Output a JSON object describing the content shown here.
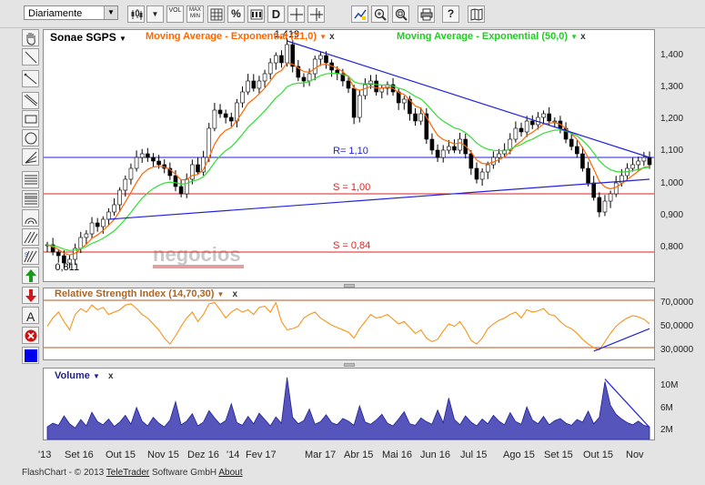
{
  "toolbar": {
    "interval": "Diariamente",
    "vol_label": "VOL",
    "maxmin_label": "MAX MIN",
    "pct_label": "%",
    "d_label": "D"
  },
  "colors": {
    "price": "#000000",
    "ema21": "#ff6600",
    "ema50": "#33dd33",
    "trendline": "#2222dd",
    "support": "#dd2222",
    "rsi": "#ff8800",
    "rsi_levels": "#bb5522",
    "volume_fill": "#5555bb",
    "accent": "#000080"
  },
  "chart_data": [
    {
      "type": "candlestick",
      "instrument": "Sonae SGPS",
      "ylim": [
        0.76,
        1.45
      ],
      "y_ticks": [
        "1,400",
        "1,300",
        "1,200",
        "1,100",
        "1,000",
        "0,900",
        "0,800"
      ],
      "series": [
        {
          "name": "Moving Average - Exponential (21,0)"
        },
        {
          "name": "Moving Average - Exponential (50,0)"
        }
      ],
      "annotations": {
        "high": "1,419",
        "low": "0,811"
      },
      "levels": [
        {
          "label": "R= 1,10",
          "value": 1.1,
          "color": "#2222dd"
        },
        {
          "label": "S = 1,00",
          "value": 1.0,
          "color": "#dd2222"
        },
        {
          "label": "S = 0,84",
          "value": 0.84,
          "color": "#dd2222"
        }
      ],
      "close": [
        0.86,
        0.84,
        0.83,
        0.81,
        0.82,
        0.85,
        0.88,
        0.89,
        0.92,
        0.91,
        0.93,
        0.95,
        0.97,
        1.01,
        1.04,
        1.07,
        1.1,
        1.11,
        1.1,
        1.09,
        1.08,
        1.07,
        1.05,
        1.02,
        1.0,
        1.04,
        1.08,
        1.06,
        1.1,
        1.18,
        1.23,
        1.22,
        1.21,
        1.2,
        1.25,
        1.28,
        1.31,
        1.29,
        1.31,
        1.33,
        1.36,
        1.38,
        1.36,
        1.41,
        1.35,
        1.32,
        1.31,
        1.33,
        1.37,
        1.38,
        1.36,
        1.34,
        1.33,
        1.31,
        1.29,
        1.21,
        1.27,
        1.3,
        1.31,
        1.28,
        1.29,
        1.3,
        1.28,
        1.25,
        1.26,
        1.22,
        1.2,
        1.22,
        1.15,
        1.12,
        1.1,
        1.12,
        1.13,
        1.12,
        1.15,
        1.11,
        1.07,
        1.04,
        1.06,
        1.08,
        1.1,
        1.11,
        1.12,
        1.15,
        1.18,
        1.17,
        1.2,
        1.19,
        1.21,
        1.22,
        1.2,
        1.2,
        1.18,
        1.15,
        1.13,
        1.11,
        1.07,
        1.03,
        0.99,
        0.95,
        0.98,
        1.0,
        1.03,
        1.05,
        1.07,
        1.08,
        1.09,
        1.1,
        1.08
      ]
    },
    {
      "type": "line",
      "title": "Relative Strength Index (14,70,30)",
      "ylim": [
        20000,
        80000
      ],
      "y_ticks": [
        "70,0000",
        "50,0000",
        "30,0000"
      ],
      "levels": [
        70,
        30
      ],
      "values": [
        48,
        55,
        60,
        52,
        45,
        58,
        63,
        60,
        66,
        62,
        64,
        58,
        60,
        62,
        66,
        67,
        63,
        58,
        55,
        50,
        45,
        38,
        33,
        40,
        48,
        55,
        60,
        52,
        58,
        67,
        68,
        62,
        55,
        60,
        63,
        60,
        62,
        58,
        64,
        65,
        60,
        68,
        52,
        45,
        46,
        48,
        55,
        58,
        60,
        55,
        52,
        49,
        47,
        45,
        43,
        38,
        46,
        52,
        58,
        55,
        56,
        58,
        54,
        50,
        52,
        47,
        42,
        45,
        38,
        35,
        37,
        44,
        50,
        48,
        52,
        45,
        36,
        33,
        38,
        46,
        50,
        53,
        55,
        58,
        60,
        55,
        62,
        60,
        61,
        63,
        58,
        57,
        52,
        48,
        46,
        42,
        37,
        33,
        30,
        28,
        35,
        42,
        48,
        52,
        55,
        57,
        56,
        54,
        50
      ]
    },
    {
      "type": "area",
      "title": "Volume",
      "y_ticks": [
        "10M",
        "6M",
        "2M"
      ],
      "values": [
        2.4,
        3.1,
        2.7,
        4.5,
        3.0,
        2.2,
        3.8,
        2.6,
        5.2,
        3.4,
        2.8,
        3.9,
        2.5,
        3.3,
        4.6,
        2.9,
        6.1,
        3.5,
        2.6,
        4.2,
        3.1,
        2.4,
        3.7,
        7.2,
        2.8,
        3.5,
        4.9,
        2.6,
        3.3,
        5.5,
        4.1,
        2.9,
        3.6,
        6.8,
        3.2,
        2.7,
        4.4,
        3.0,
        5.0,
        3.8,
        2.6,
        4.3,
        3.1,
        11.8,
        4.2,
        3.0,
        3.6,
        5.8,
        2.9,
        3.4,
        4.7,
        3.2,
        2.8,
        4.0,
        3.5,
        2.7,
        6.4,
        3.3,
        2.9,
        3.7,
        4.8,
        3.1,
        2.6,
        3.9,
        5.3,
        3.0,
        2.7,
        4.1,
        3.4,
        2.9,
        5.6,
        3.2,
        7.9,
        3.8,
        2.8,
        4.5,
        3.3,
        2.6,
        3.9,
        3.0,
        4.6,
        3.5,
        2.8,
        5.1,
        3.4,
        2.9,
        6.2,
        3.7,
        3.0,
        4.4,
        2.8,
        3.6,
        4.0,
        3.1,
        2.7,
        3.8,
        3.3,
        5.4,
        3.0,
        4.2,
        11.0,
        6.5,
        4.8,
        3.9,
        3.2,
        2.8,
        3.5,
        2.7,
        2.4
      ]
    }
  ],
  "x_axis": [
    "'13",
    "Set 16",
    "Out 15",
    "Nov 15",
    "Dez 16",
    "'14",
    "Fev 17",
    "Mar 17",
    "Abr 15",
    "Mai 16",
    "Jun 16",
    "Jul 15",
    "Ago 15",
    "Set 15",
    "Out 15",
    "Nov"
  ],
  "footer": {
    "prefix": "FlashChart - © 2013 ",
    "company": "TeleTrader",
    "mid": " Software GmbH ",
    "about": "About"
  },
  "watermark": "negocios"
}
